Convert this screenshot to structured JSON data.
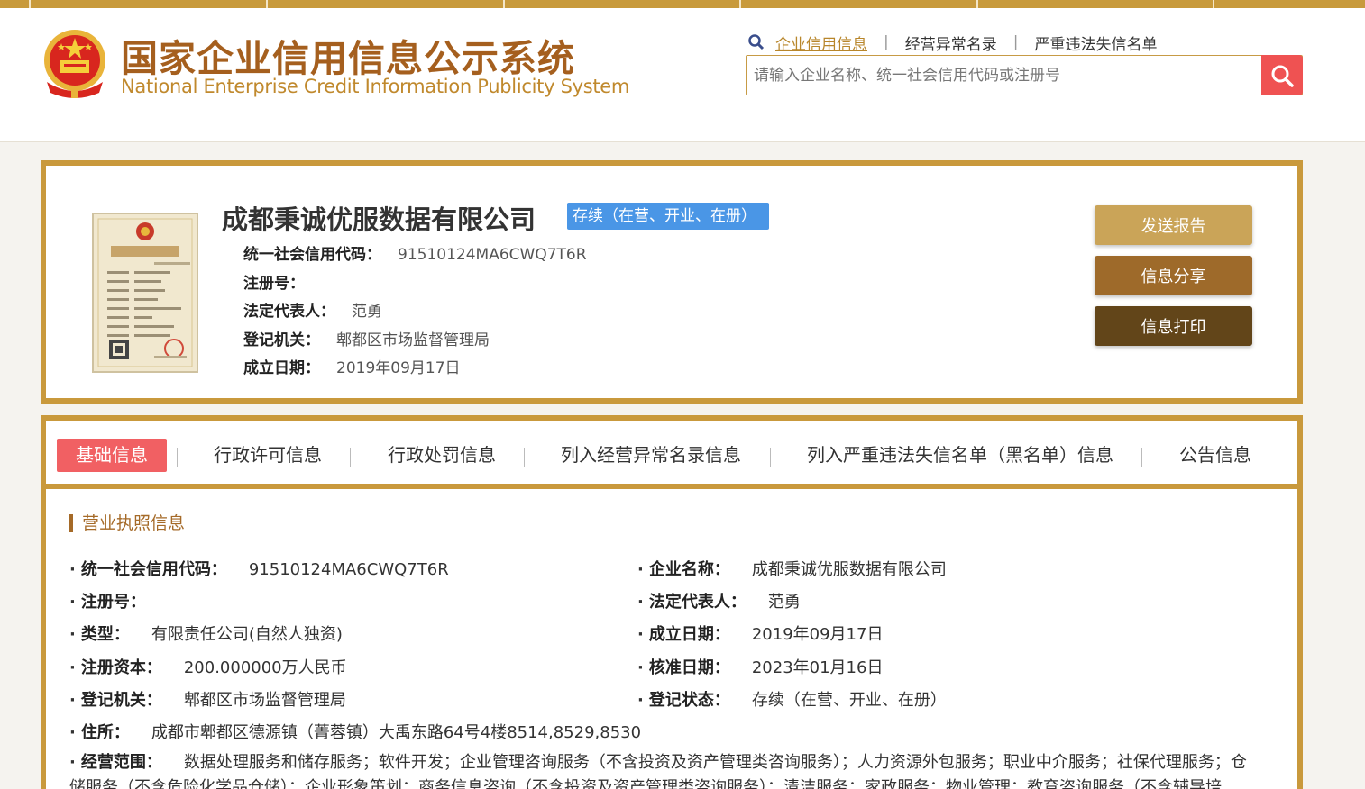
{
  "header": {
    "title_cn": "国家企业信用信息公示系统",
    "title_en": "National Enterprise Credit Information Publicity System",
    "nav": [
      "企业信用信息",
      "经营异常名录",
      "严重违法失信名单"
    ],
    "search_placeholder": "请输入企业名称、统一社会信用代码或注册号"
  },
  "company": {
    "name": "成都秉诚优服数据有限公司",
    "status": "存续（在营、开业、在册）",
    "fields": [
      {
        "label": "统一社会信用代码：",
        "value": "91510124MA6CWQ7T6R"
      },
      {
        "label": "注册号：",
        "value": ""
      },
      {
        "label": "法定代表人：",
        "value": "范勇"
      },
      {
        "label": "登记机关：",
        "value": "郫都区市场监督管理局"
      },
      {
        "label": "成立日期：",
        "value": "2019年09月17日"
      }
    ]
  },
  "actions": {
    "send_report": "发送报告",
    "share": "信息分享",
    "print": "信息打印"
  },
  "tabs": [
    "基础信息",
    "行政许可信息",
    "行政处罚信息",
    "列入经营异常名录信息",
    "列入严重违法失信名单（黑名单）信息",
    "公告信息"
  ],
  "section": {
    "title": "营业执照信息",
    "left": [
      {
        "label": "统一社会信用代码：",
        "value": "91510124MA6CWQ7T6R"
      },
      {
        "label": "注册号：",
        "value": ""
      },
      {
        "label": "类型：",
        "value": "有限责任公司(自然人独资)"
      },
      {
        "label": "注册资本：",
        "value": "200.000000万人民币"
      },
      {
        "label": "登记机关：",
        "value": "郫都区市场监督管理局"
      },
      {
        "label": "住所：",
        "value": "成都市郫都区德源镇（菁蓉镇）大禹东路64号4楼8514,8529,8530"
      }
    ],
    "right": [
      {
        "label": "企业名称：",
        "value": "成都秉诚优服数据有限公司"
      },
      {
        "label": "法定代表人：",
        "value": "范勇"
      },
      {
        "label": "成立日期：",
        "value": "2019年09月17日"
      },
      {
        "label": "核准日期：",
        "value": "2023年01月16日"
      },
      {
        "label": "登记状态：",
        "value": "存续（在营、开业、在册）"
      }
    ],
    "scope": {
      "label": "经营范围：",
      "value": "数据处理服务和储存服务；软件开发；企业管理咨询服务（不含投资及资产管理类咨询服务）；人力资源外包服务；职业中介服务；社保代理服务；仓储服务（不含危险化学品仓储）；企业形象策划；商务信息咨询（不含投资及资产管理类咨询服务）；清洁服务；家政服务；物业管理；教育咨询服务（不含辅导培训）；会议"
    }
  }
}
